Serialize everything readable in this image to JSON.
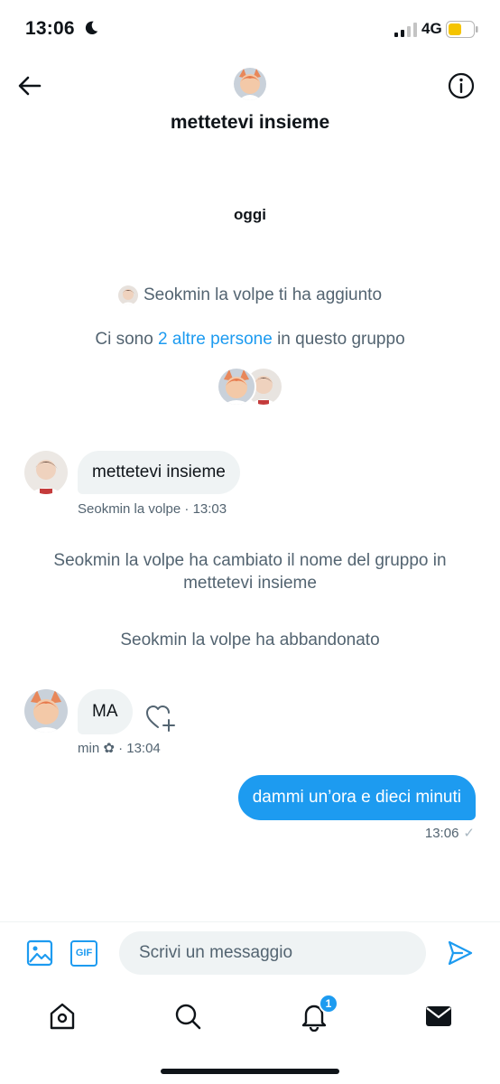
{
  "status_bar": {
    "time": "13:06",
    "network": "4G",
    "battery_color": "#f5c400"
  },
  "header": {
    "title": "mettetevi insieme"
  },
  "conversation": {
    "date_divider": "oggi",
    "system_added": "Seokmin la volpe ti ha aggiunto",
    "members_prefix": "Ci sono ",
    "members_link": "2 altre persone",
    "members_suffix": " in questo gruppo",
    "msg1": {
      "text": "mettetevi insieme",
      "sender": "Seokmin la volpe",
      "time": "· 13:03"
    },
    "system_rename_line1": "Seokmin la volpe ha cambiato il nome del gruppo in",
    "system_rename_line2": "mettetevi insieme",
    "system_left": "Seokmin la volpe ha abbandonato",
    "msg2": {
      "text": "MA",
      "sender": "min ✿",
      "time": "· 13:04"
    },
    "msg3": {
      "text": "dammi un’ora e dieci minuti",
      "time": "13:06",
      "status": "✓"
    }
  },
  "composer": {
    "placeholder": "Scrivi un messaggio",
    "gif_label": "GIF"
  },
  "tabbar": {
    "notifications_badge": "1"
  },
  "colors": {
    "accent": "#1d9bf0",
    "bubble_in": "#eff3f4",
    "muted": "#536471"
  },
  "icons": [
    "back-arrow-icon",
    "info-icon",
    "image-icon",
    "gif-icon",
    "send-icon",
    "home-icon",
    "search-icon",
    "bell-icon",
    "mail-icon",
    "heart-plus-icon",
    "moon-icon",
    "signal-icon",
    "battery-icon"
  ]
}
